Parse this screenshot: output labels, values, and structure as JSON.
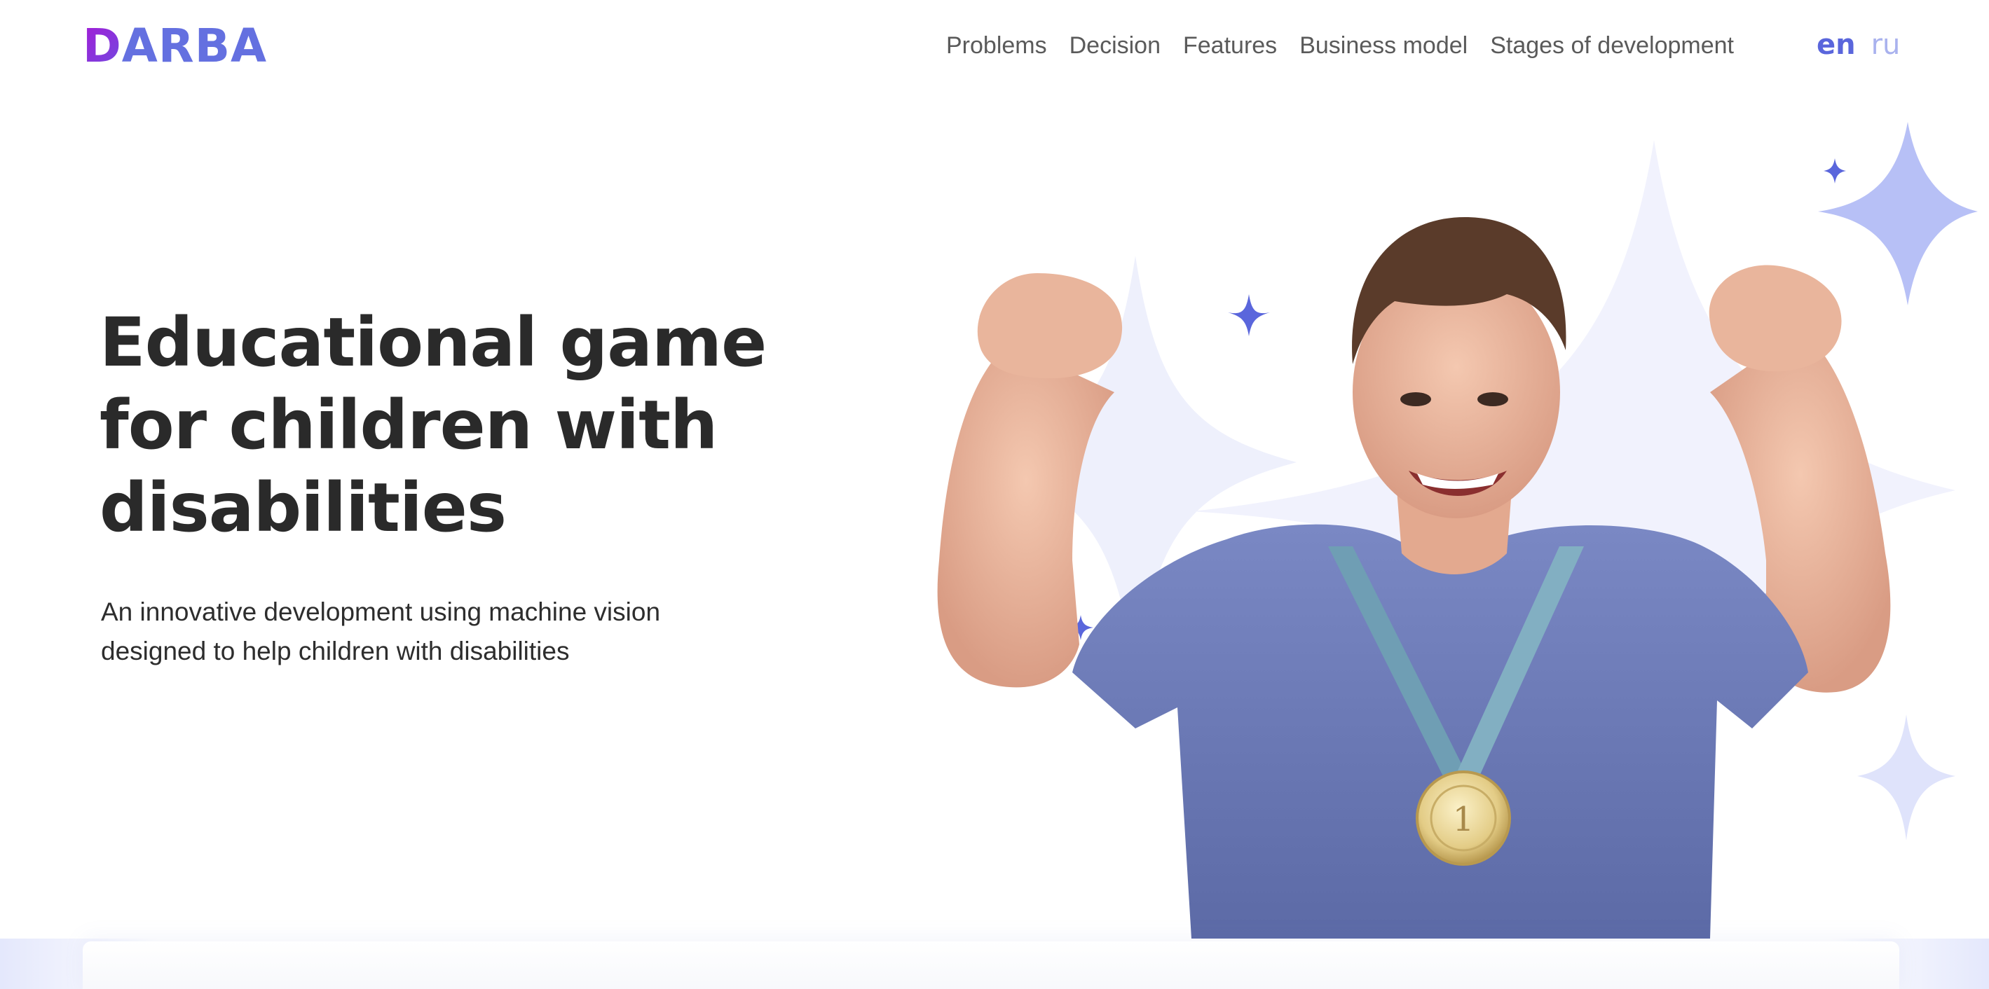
{
  "brand": {
    "logo_first": "D",
    "logo_rest": "ARBA",
    "accent": "#6470e0",
    "logo_gradient_start": "#a51ad6"
  },
  "nav": {
    "items": [
      {
        "label": "Problems"
      },
      {
        "label": "Decision"
      },
      {
        "label": "Features"
      },
      {
        "label": "Business model"
      },
      {
        "label": "Stages of development"
      }
    ]
  },
  "lang": {
    "en": "en",
    "ru": "ru",
    "active": "en"
  },
  "hero": {
    "title": "Educational game for children with disabilities",
    "subtitle": "An innovative development using machine vision designed to help children with disabilities",
    "medal_text": "1",
    "star_color": "#5a66dc",
    "soft_star_color": "#b7c0f6",
    "shirt_color": "#6b7bb8"
  }
}
